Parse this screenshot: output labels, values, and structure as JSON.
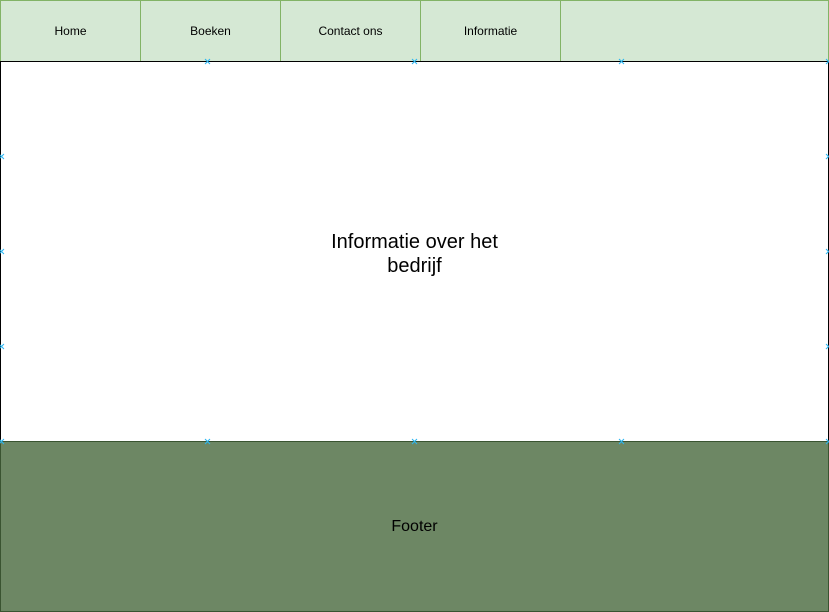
{
  "nav": {
    "items": [
      {
        "label": "Home"
      },
      {
        "label": "Boeken"
      },
      {
        "label": "Contact ons"
      },
      {
        "label": "Informatie"
      },
      {
        "label": ""
      }
    ]
  },
  "main": {
    "text": "Informatie over het bedrijf"
  },
  "footer": {
    "text": "Footer"
  },
  "colors": {
    "nav_fill": "#d5e8d4",
    "nav_stroke": "#82b366",
    "footer_fill": "#6d8764",
    "connection_point": "#29b6f2"
  }
}
